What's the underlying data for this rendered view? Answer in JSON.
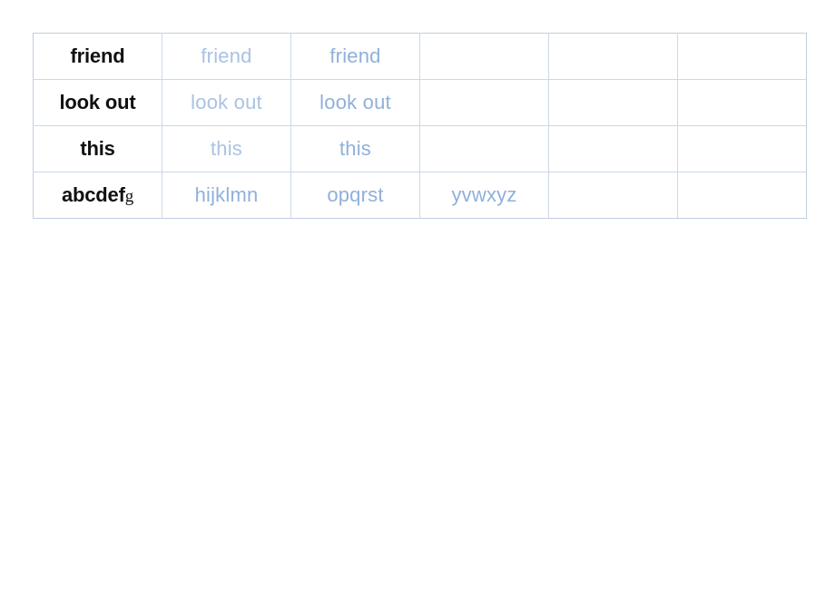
{
  "document": {
    "title": "Handwriting practice word table",
    "background_color": "#ffffff"
  },
  "table": {
    "border_color": "#c0cfe0",
    "inner_border_color": "#ccd8e6",
    "column_count": 6,
    "row_count": 4,
    "prompt_text_color": "#111111",
    "trace_text_color": "#a9c3e3",
    "trace_strong_text_color": "#8fb0da",
    "rows": [
      {
        "name": "row-friend",
        "cells": [
          {
            "text": "friend",
            "style": "prompt"
          },
          {
            "text": "friend",
            "style": "trace"
          },
          {
            "text": "friend",
            "style": "trace-strong"
          },
          {
            "text": "",
            "style": "empty"
          },
          {
            "text": "",
            "style": "empty"
          },
          {
            "text": "",
            "style": "empty"
          }
        ]
      },
      {
        "name": "row-look-out",
        "cells": [
          {
            "text": "look out",
            "style": "prompt"
          },
          {
            "text": "look out",
            "style": "trace"
          },
          {
            "text": "look out",
            "style": "trace-strong"
          },
          {
            "text": "",
            "style": "empty"
          },
          {
            "text": "",
            "style": "empty"
          },
          {
            "text": "",
            "style": "empty"
          }
        ]
      },
      {
        "name": "row-this",
        "cells": [
          {
            "text": "this",
            "style": "prompt"
          },
          {
            "text": "this",
            "style": "trace"
          },
          {
            "text": "this",
            "style": "trace-strong"
          },
          {
            "text": "",
            "style": "empty"
          },
          {
            "text": "",
            "style": "empty"
          },
          {
            "text": "",
            "style": "empty"
          }
        ]
      },
      {
        "name": "row-alphabet",
        "cells": [
          {
            "text": "abcdef",
            "suffix": "g",
            "style": "prompt"
          },
          {
            "text": "hijklmn",
            "style": "trace-strong"
          },
          {
            "text": "opqrst",
            "style": "trace-strong"
          },
          {
            "text": "yvwxyz",
            "style": "trace-strong"
          },
          {
            "text": "",
            "style": "empty"
          },
          {
            "text": "",
            "style": "empty"
          }
        ]
      }
    ]
  }
}
